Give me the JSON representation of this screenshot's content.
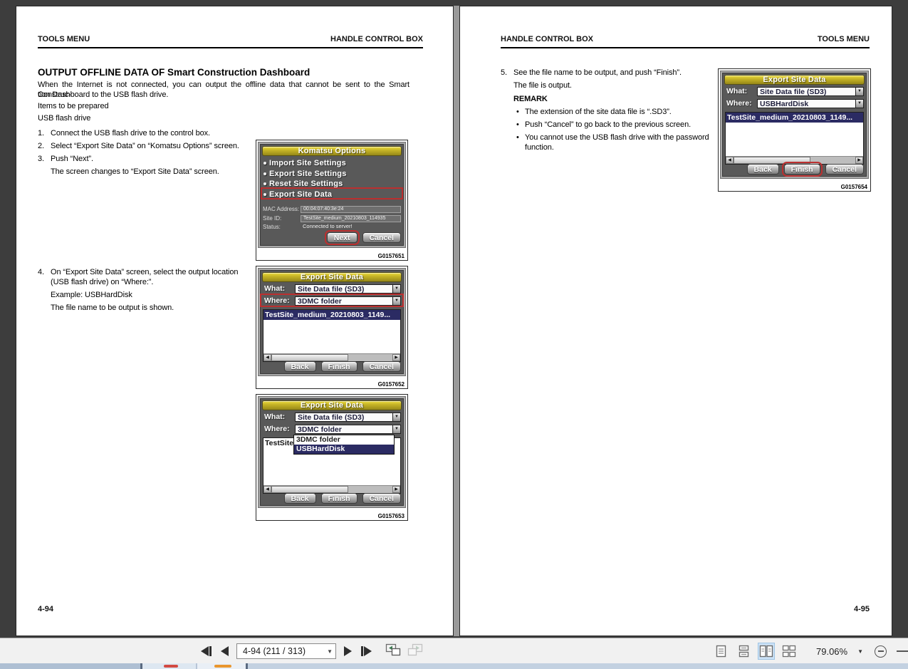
{
  "pages": {
    "left": {
      "header_left": "TOOLS MENU",
      "header_right": "HANDLE CONTROL BOX",
      "heading": "OUTPUT OFFLINE DATA OF Smart Construction Dashboard",
      "intro_line1": "When the Internet is not connected, you can output the offline data that cannot be sent to the Smart Construc-",
      "intro_line2": "tion Dashboard to the USB flash drive.",
      "prep_label": "Items to be prepared",
      "prep_item": "USB flash drive",
      "steps": [
        {
          "num": "1.",
          "text": "Connect the USB flash drive to the control box."
        },
        {
          "num": "2.",
          "text": "Select “Export Site Data” on “Komatsu Options” screen."
        },
        {
          "num": "3.",
          "text": "Push “Next”.",
          "sub0": "The screen changes to “Export Site Data” screen."
        },
        {
          "num": "4.",
          "text": "On “Export Site Data” screen, select the output location (USB flash drive) on “Where:”.",
          "sub0": "Example: USBHardDisk",
          "sub1": "The file name to be output is shown."
        }
      ],
      "page_number": "4-94"
    },
    "right": {
      "header_left": "HANDLE CONTROL BOX",
      "header_right": "TOOLS MENU",
      "step_num": "5.",
      "step_text": "See the file name to be output, and push “Finish”.",
      "step_sub": "The file is output.",
      "remark_label": "REMARK",
      "remarks": [
        "The extension of the site data file is “.SD3”.",
        "Push “Cancel” to go back to the previous screen.",
        "You cannot use the USB flash drive with the password function."
      ],
      "bullet_char": "•",
      "page_number": "4-95"
    }
  },
  "figures": {
    "komatsu": {
      "title": "Komatsu Options",
      "items": [
        "Import Site Settings",
        "Export Site Settings",
        "Reset Site Settings",
        "Export Site Data"
      ],
      "mac_label": "MAC Address:",
      "mac_value": "00:04:07:40:3e:24",
      "site_label": "Site ID:",
      "site_value": "TestSite_medium_20210803_114935",
      "status_label": "Status:",
      "status_value": "Connected to server!",
      "next_btn": "Next",
      "cancel_btn": "Cancel",
      "caption": "G0157651"
    },
    "export1": {
      "title": "Export Site Data",
      "what_label": "What:",
      "what_value": "Site Data file (SD3)",
      "where_label": "Where:",
      "where_value": "3DMC folder",
      "file": "TestSite_medium_20210803_1149...",
      "back_btn": "Back",
      "finish_btn": "Finish",
      "cancel_btn": "Cancel",
      "caption": "G0157652"
    },
    "export2": {
      "title": "Export Site Data",
      "what_label": "What:",
      "what_value": "Site Data file (SD3)",
      "where_label": "Where:",
      "where_value": "3DMC folder",
      "dropdown_items": [
        "3DMC folder",
        "USBHardDisk"
      ],
      "file_partial": "TestSite_",
      "back_btn": "Back",
      "finish_btn": "Finish",
      "cancel_btn": "Cancel",
      "caption": "G0157653"
    },
    "export3": {
      "title": "Export Site Data",
      "what_label": "What:",
      "what_value": "Site Data file (SD3)",
      "where_label": "Where:",
      "where_value": "USBHardDisk",
      "file": "TestSite_medium_20210803_1149...",
      "back_btn": "Back",
      "finish_btn": "Finish",
      "cancel_btn": "Cancel",
      "caption": "G0157654"
    },
    "scroll_left": "◀",
    "scroll_right": "▶",
    "combo_arrow": "▼"
  },
  "toolbar": {
    "page_field": "4-94 (211 / 313)",
    "zoom_value": "79.06%"
  }
}
